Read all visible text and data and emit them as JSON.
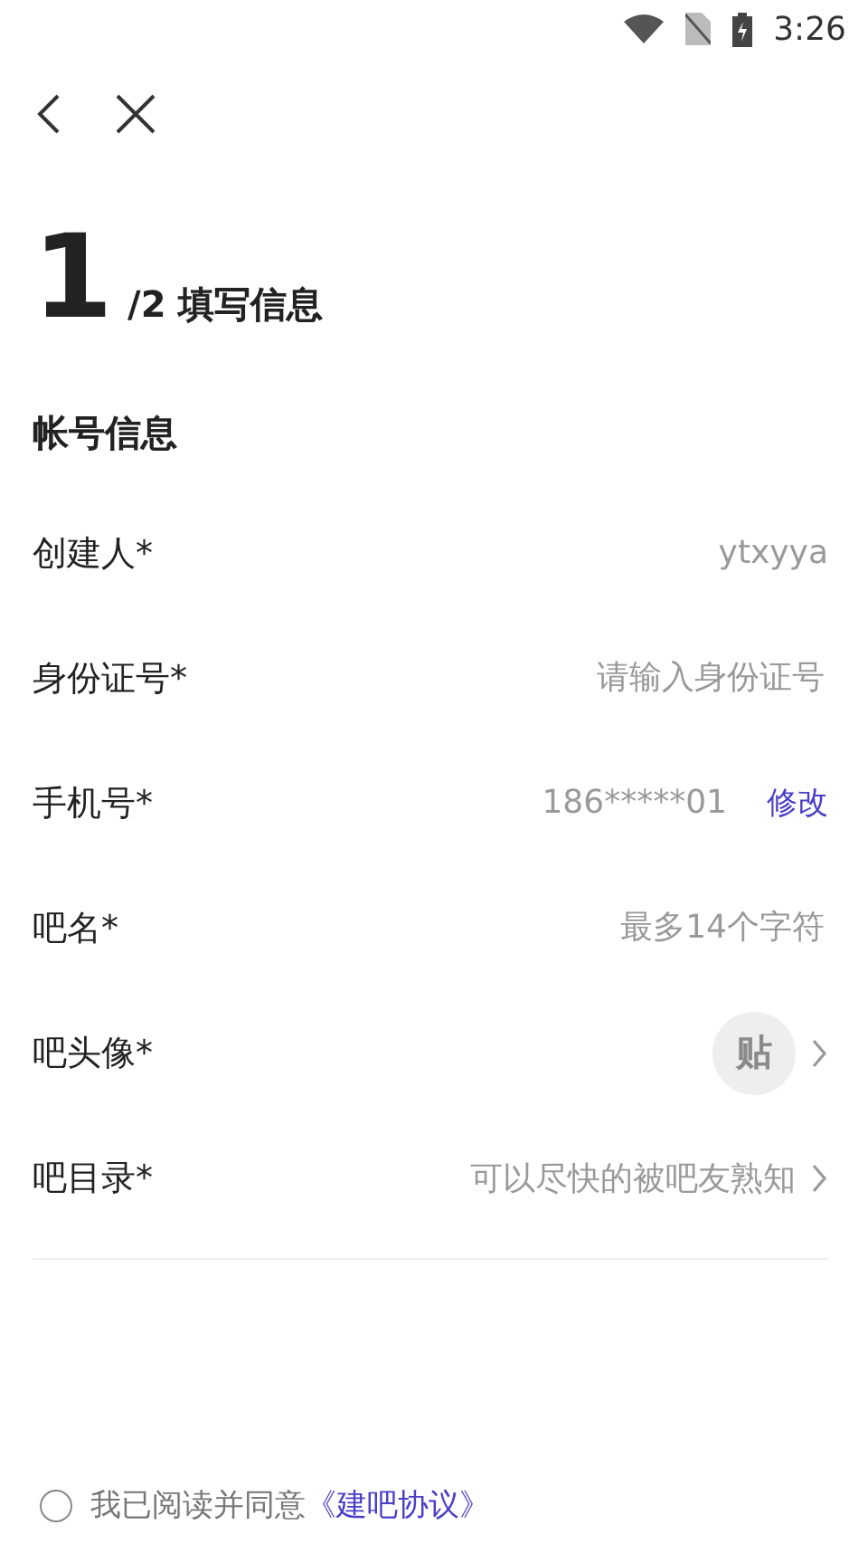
{
  "status_bar": {
    "time": "3:26"
  },
  "step": {
    "current": "1",
    "rest": "/2 填写信息"
  },
  "section_title": "帐号信息",
  "rows": [
    {
      "kind": "value",
      "label": "创建人*",
      "value": "ytxyya"
    },
    {
      "kind": "field",
      "label": "身份证号*",
      "placeholder": "请输入身份证号"
    },
    {
      "kind": "phone",
      "label": "手机号*",
      "value": "186*****01",
      "action": "修改"
    },
    {
      "kind": "field",
      "label": "吧名*",
      "placeholder": "最多14个字符"
    },
    {
      "kind": "avatar",
      "label": "吧头像*",
      "glyph": "贴"
    },
    {
      "kind": "picker",
      "label": "吧目录*",
      "value": "可以尽快的被吧友熟知"
    }
  ],
  "agreement": {
    "checked": false,
    "text": "我已阅读并同意",
    "link": "《建吧协议》"
  }
}
